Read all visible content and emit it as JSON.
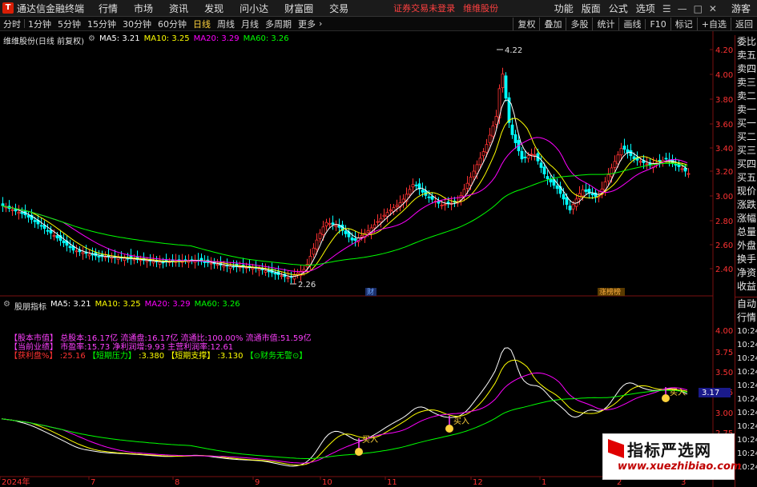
{
  "menubar": {
    "app_title": "通达信金融终端",
    "logo_text": "T",
    "items": [
      "行情",
      "市场",
      "资讯",
      "发现",
      "问小达",
      "财富圈",
      "交易"
    ],
    "login_status": "证券交易未登录",
    "stock_name": "维维股份",
    "right_items": [
      "功能",
      "版面",
      "公式",
      "选项"
    ],
    "guest": "游客"
  },
  "periods": {
    "items": [
      "分时",
      "1分钟",
      "5分钟",
      "15分钟",
      "30分钟",
      "60分钟",
      "日线",
      "周线",
      "月线",
      "多周期",
      "更多"
    ],
    "active": "日线"
  },
  "chart_tools": [
    "复权",
    "叠加",
    "多股",
    "统计",
    "画线",
    "F10",
    "标记",
    "+自选",
    "返回"
  ],
  "main_legend": {
    "title": "维维股份(日线 前复权)",
    "ma5": "MA5: 3.21",
    "ma10": "MA10: 3.25",
    "ma20": "MA20: 3.29",
    "ma60": "MA60: 3.26"
  },
  "indicator_legend": {
    "title": "股朋指标",
    "ma5": "MA5: 3.21",
    "ma10": "MA10: 3.25",
    "ma20": "MA20: 3.29",
    "ma60": "MA60: 3.26"
  },
  "info_lines": {
    "line1a": "【股本市值】",
    "line1b": "总股本:16.17亿 流通盘:16.17亿 流通比:100.00% 流通市值:51.59亿",
    "line2a": "【当前业绩】",
    "line2b": "市盈率:15.73 净利润增:9.93 主营利润率:12.61",
    "line3a": "【获利盘%】",
    "line3b": ":25.16",
    "line3c": "【短期压力】",
    "line3d": ":3.380",
    "line3e": "【短期支撑】",
    "line3f": ":3.130",
    "line3g": "【⊙财务无警⊙】"
  },
  "markers": {
    "high": "4.22",
    "low": "2.26",
    "cai": "财",
    "zhangtingbang": "涨榜榜",
    "buy": "买入",
    "current_price": "3.17"
  },
  "axis": {
    "main_ticks": [
      "4.20",
      "4.00",
      "3.80",
      "3.60",
      "3.40",
      "3.20",
      "3.00",
      "2.80",
      "2.60",
      "2.40"
    ],
    "ind_ticks": [
      "4.00",
      "3.75",
      "3.50",
      "3.25",
      "3.00",
      "2.75"
    ],
    "x_labels": [
      "2024年",
      "7",
      "8",
      "9",
      "10",
      "11",
      "12",
      "1",
      "2",
      "3"
    ]
  },
  "quote_col": {
    "labels": [
      "委比",
      "卖五",
      "卖四",
      "卖三",
      "卖二",
      "卖一",
      "买一",
      "买二",
      "买三",
      "买四",
      "买五",
      "现价",
      "涨跌",
      "涨幅",
      "总量",
      "外盘",
      "换手",
      "净资",
      "收益"
    ],
    "labels2": [
      "自动",
      "行情"
    ],
    "times": [
      "10:24",
      "10:24",
      "10:24",
      "10:24",
      "10:24",
      "10:24",
      "10:24",
      "10:24",
      "10:24",
      "10:24",
      "10:24"
    ]
  },
  "watermark": {
    "title": "指标严选网",
    "url": "www.xuezhibiao.com"
  },
  "colors": {
    "up": "#ff3232",
    "down": "#00ffff",
    "ma5": "#ffffff",
    "ma10": "#ffff00",
    "ma20": "#ff00ff",
    "ma60": "#00ff00"
  }
}
